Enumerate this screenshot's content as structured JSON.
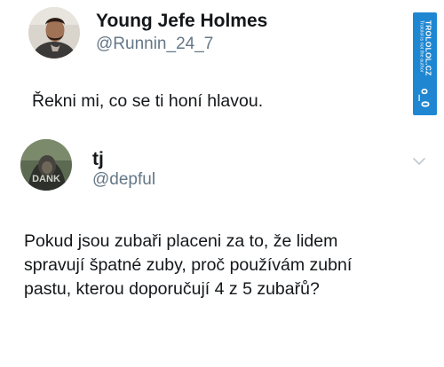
{
  "tweet1": {
    "display_name": "Young Jefe Holmes",
    "handle": "@Runnin_24_7",
    "text": "Řekni mi, co se ti honí hlavou."
  },
  "tweet2": {
    "display_name": "tj",
    "handle": "@depful",
    "text": "Pokud jsou zubaři placeni za to, že lidem\nspravují špatné zuby, proč používám zubní\npastu, kterou doporučují 4 z 5 zubařů?",
    "avatar_text": "DANK"
  },
  "watermark": {
    "brand": "TROLOLOL.CZ",
    "subtitle": "Trololol is not the author",
    "face": "o_O"
  },
  "colors": {
    "text": "#14171a",
    "secondary": "#657786",
    "watermark_bg": "#1f87d1"
  },
  "icons": {
    "menu": "chevron-down-icon"
  }
}
